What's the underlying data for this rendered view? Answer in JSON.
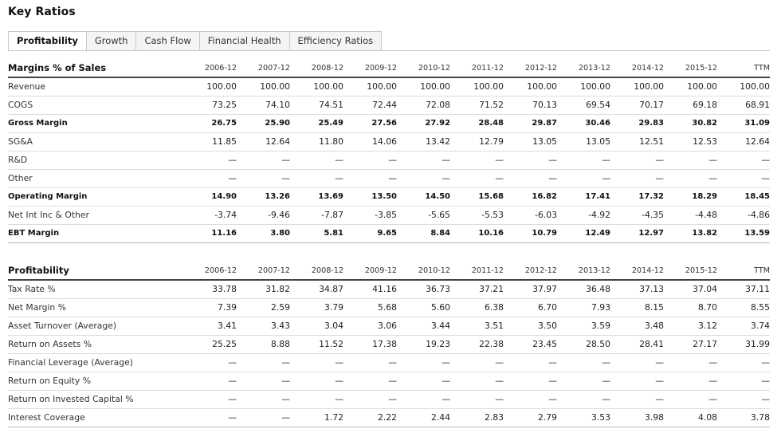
{
  "page": {
    "title": "Key Ratios"
  },
  "tabs": [
    {
      "label": "Profitability",
      "active": true
    },
    {
      "label": "Growth",
      "active": false
    },
    {
      "label": "Cash Flow",
      "active": false
    },
    {
      "label": "Financial Health",
      "active": false
    },
    {
      "label": "Efficiency Ratios",
      "active": false
    }
  ],
  "margins": {
    "title": "Margins % of Sales",
    "columns": [
      "2006-12",
      "2007-12",
      "2008-12",
      "2009-12",
      "2010-12",
      "2011-12",
      "2012-12",
      "2013-12",
      "2014-12",
      "2015-12",
      "TTM"
    ],
    "rows": [
      {
        "label": "Revenue",
        "bold": false,
        "values": [
          "100.00",
          "100.00",
          "100.00",
          "100.00",
          "100.00",
          "100.00",
          "100.00",
          "100.00",
          "100.00",
          "100.00",
          "100.00"
        ]
      },
      {
        "label": "COGS",
        "bold": false,
        "values": [
          "73.25",
          "74.10",
          "74.51",
          "72.44",
          "72.08",
          "71.52",
          "70.13",
          "69.54",
          "70.17",
          "69.18",
          "68.91"
        ]
      },
      {
        "label": "Gross Margin",
        "bold": true,
        "values": [
          "26.75",
          "25.90",
          "25.49",
          "27.56",
          "27.92",
          "28.48",
          "29.87",
          "30.46",
          "29.83",
          "30.82",
          "31.09"
        ]
      },
      {
        "label": "SG&A",
        "bold": false,
        "values": [
          "11.85",
          "12.64",
          "11.80",
          "14.06",
          "13.42",
          "12.79",
          "13.05",
          "13.05",
          "12.51",
          "12.53",
          "12.64"
        ]
      },
      {
        "label": "R&D",
        "bold": false,
        "values": [
          "—",
          "—",
          "—",
          "—",
          "—",
          "—",
          "—",
          "—",
          "—",
          "—",
          "—"
        ]
      },
      {
        "label": "Other",
        "bold": false,
        "values": [
          "—",
          "—",
          "—",
          "—",
          "—",
          "—",
          "—",
          "—",
          "—",
          "—",
          "—"
        ]
      },
      {
        "label": "Operating Margin",
        "bold": true,
        "values": [
          "14.90",
          "13.26",
          "13.69",
          "13.50",
          "14.50",
          "15.68",
          "16.82",
          "17.41",
          "17.32",
          "18.29",
          "18.45"
        ]
      },
      {
        "label": "Net Int Inc & Other",
        "bold": false,
        "values": [
          "-3.74",
          "-9.46",
          "-7.87",
          "-3.85",
          "-5.65",
          "-5.53",
          "-6.03",
          "-4.92",
          "-4.35",
          "-4.48",
          "-4.86"
        ]
      },
      {
        "label": "EBT Margin",
        "bold": true,
        "values": [
          "11.16",
          "3.80",
          "5.81",
          "9.65",
          "8.84",
          "10.16",
          "10.79",
          "12.49",
          "12.97",
          "13.82",
          "13.59"
        ]
      }
    ]
  },
  "profitability": {
    "title": "Profitability",
    "columns": [
      "2006-12",
      "2007-12",
      "2008-12",
      "2009-12",
      "2010-12",
      "2011-12",
      "2012-12",
      "2013-12",
      "2014-12",
      "2015-12",
      "TTM"
    ],
    "rows": [
      {
        "label": "Tax Rate %",
        "bold": false,
        "values": [
          "33.78",
          "31.82",
          "34.87",
          "41.16",
          "36.73",
          "37.21",
          "37.97",
          "36.48",
          "37.13",
          "37.04",
          "37.11"
        ]
      },
      {
        "label": "Net Margin %",
        "bold": false,
        "values": [
          "7.39",
          "2.59",
          "3.79",
          "5.68",
          "5.60",
          "6.38",
          "6.70",
          "7.93",
          "8.15",
          "8.70",
          "8.55"
        ]
      },
      {
        "label": "Asset Turnover (Average)",
        "bold": false,
        "values": [
          "3.41",
          "3.43",
          "3.04",
          "3.06",
          "3.44",
          "3.51",
          "3.50",
          "3.59",
          "3.48",
          "3.12",
          "3.74"
        ]
      },
      {
        "label": "Return on Assets %",
        "bold": false,
        "values": [
          "25.25",
          "8.88",
          "11.52",
          "17.38",
          "19.23",
          "22.38",
          "23.45",
          "28.50",
          "28.41",
          "27.17",
          "31.99"
        ]
      },
      {
        "label": "Financial Leverage (Average)",
        "bold": false,
        "values": [
          "—",
          "—",
          "—",
          "—",
          "—",
          "—",
          "—",
          "—",
          "—",
          "—",
          "—"
        ]
      },
      {
        "label": "Return on Equity %",
        "bold": false,
        "values": [
          "—",
          "—",
          "—",
          "—",
          "—",
          "—",
          "—",
          "—",
          "—",
          "—",
          "—"
        ]
      },
      {
        "label": "Return on Invested Capital %",
        "bold": false,
        "values": [
          "—",
          "—",
          "—",
          "—",
          "—",
          "—",
          "—",
          "—",
          "—",
          "—",
          "—"
        ]
      },
      {
        "label": "Interest Coverage",
        "bold": false,
        "values": [
          "—",
          "—",
          "1.72",
          "2.22",
          "2.44",
          "2.83",
          "2.79",
          "3.53",
          "3.98",
          "4.08",
          "3.78"
        ]
      }
    ]
  }
}
